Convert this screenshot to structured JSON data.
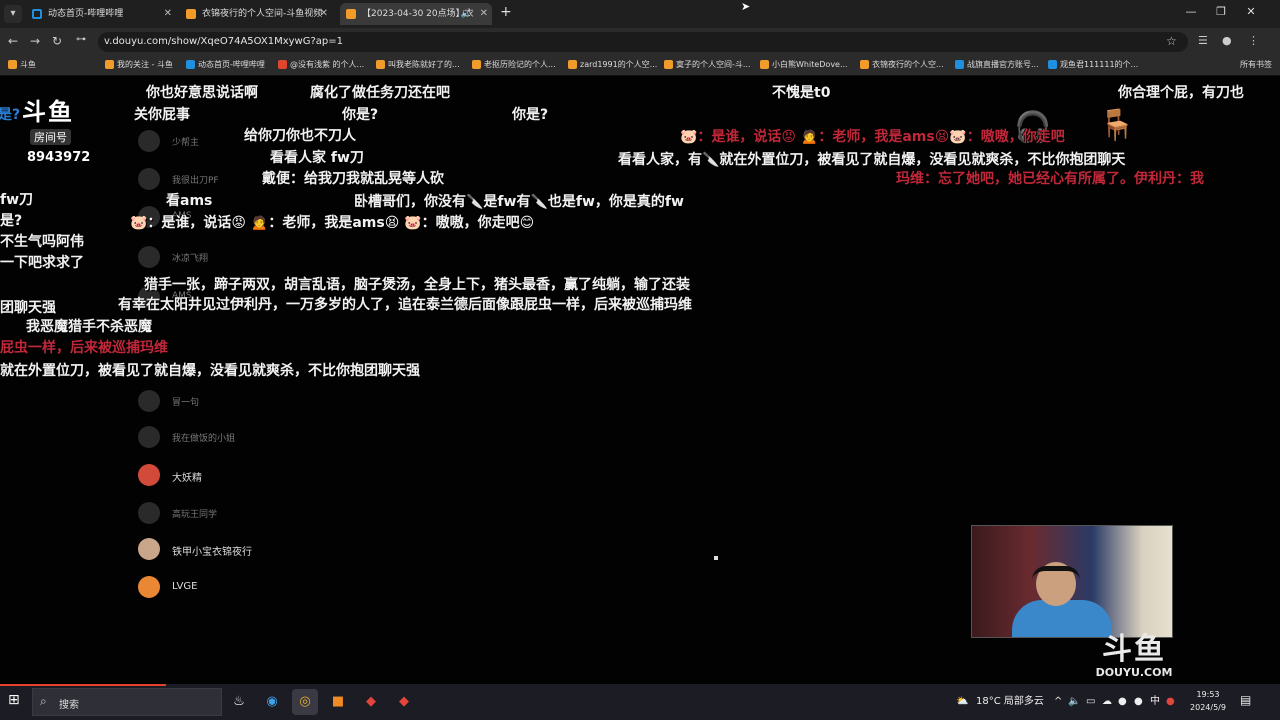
{
  "browser": {
    "tabs": [
      {
        "title": "动态首页-哔哩哔哩",
        "active": false,
        "fav": "#1f8fe0"
      },
      {
        "title": "衣锦夜行的个人空间-斗鱼视频",
        "active": false,
        "fav": "#f19c2a"
      },
      {
        "title": "【2023-04-30 20点场】衣",
        "active": true,
        "fav": "#f19c2a"
      }
    ],
    "url": "v.douyu.com/show/XqeO74A5OX1MxywG?ap=1",
    "bookmarks": [
      {
        "label": "斗鱼",
        "color": "#f19c2a"
      },
      {
        "label": "我的关注 - 斗鱼",
        "color": "#f19c2a"
      },
      {
        "label": "动态首页-哔哩哔哩",
        "color": "#1f8fe0"
      },
      {
        "label": "@没有浅紫 的个人...",
        "color": "#e0452f"
      },
      {
        "label": "叫我老陈就好了的...",
        "color": "#f19c2a"
      },
      {
        "label": "老抠历险记的个人...",
        "color": "#f19c2a"
      },
      {
        "label": "zard1991的个人空...",
        "color": "#f19c2a"
      },
      {
        "label": "寞子的个人空间-斗...",
        "color": "#f19c2a"
      },
      {
        "label": "小白熊WhiteDove...",
        "color": "#f19c2a"
      },
      {
        "label": "衣锦夜行的个人空...",
        "color": "#f19c2a"
      },
      {
        "label": "战旗直播官方账号...",
        "color": "#1f8fe0"
      },
      {
        "label": "观鱼君111111的个...",
        "color": "#1f8fe0"
      }
    ],
    "all_bookmarks": "所有书签"
  },
  "stream": {
    "logo_main": "斗鱼",
    "logo_sub": "房间号",
    "room_number": "8943972",
    "watermark_main": "斗鱼",
    "watermark_domain": "DOUYU.COM"
  },
  "danmaku": [
    {
      "text": "你也好意思说话啊",
      "cls": "white"
    },
    {
      "text": "腐化了做任务刀还在吧",
      "cls": "white"
    },
    {
      "text": "不愧是t0",
      "cls": "white"
    },
    {
      "text": "你合理个屁，有刀也",
      "cls": "white"
    },
    {
      "text": "是?",
      "cls": "blue"
    },
    {
      "text": "关你屁事",
      "cls": "white"
    },
    {
      "text": "你是?",
      "cls": "white"
    },
    {
      "text": "你是?",
      "cls": "white"
    },
    {
      "text": "给你刀你也不刀人",
      "cls": "white"
    },
    {
      "text": "🐷：是谁，说话😡  🙍：老师，我是ams😫🐷：嗷嗷，你走吧",
      "cls": "red"
    },
    {
      "text": "看看人家 fw刀",
      "cls": "white"
    },
    {
      "text": "看看人家，有🔪就在外置位刀，被看见了就自爆，没看见就爽杀，不比你抱团聊天",
      "cls": "white"
    },
    {
      "text": "戴便：给我刀我就乱晃等人砍",
      "cls": "white"
    },
    {
      "text": "玛维：忘了她吧，她已经心有所属了。伊利丹：我",
      "cls": "red"
    },
    {
      "text": "fw刀",
      "cls": "white"
    },
    {
      "text": "看ams",
      "cls": "white"
    },
    {
      "text": "卧槽哥们，你没有🔪是fw有🔪也是fw，你是真的fw",
      "cls": "white"
    },
    {
      "text": "是?",
      "cls": "white"
    },
    {
      "text": "🐷：是谁，说话😡  🙍：老师，我是ams😫  🐷：嗷嗷，你走吧😊",
      "cls": "white"
    },
    {
      "text": "不生气吗阿伟",
      "cls": "white"
    },
    {
      "text": "一下吧求求了",
      "cls": "white"
    },
    {
      "text": "猎手一张，蹄子两双，胡言乱语，脑子煲汤，全身上下，猪头最香，赢了纯躺，输了还装",
      "cls": "white"
    },
    {
      "text": "有幸在太阳井见过伊利丹，一万多岁的人了，追在泰兰德后面像跟屁虫一样，后来被巡捕玛维",
      "cls": "white"
    },
    {
      "text": "团聊天强",
      "cls": "white"
    },
    {
      "text": "我恶魔猎手不杀恶魔",
      "cls": "white"
    },
    {
      "text": "屁虫一样，后来被巡捕玛维",
      "cls": "red"
    },
    {
      "text": "就在外置位刀，被看见了就自爆，没看见就爽杀，不比你抱团聊天强",
      "cls": "white"
    }
  ],
  "players": [
    {
      "name": "少帮主",
      "bright": false
    },
    {
      "name": "我很出刀PF",
      "bright": false
    },
    {
      "name": "AMS",
      "bright": false
    },
    {
      "name": "冰凉飞翔",
      "bright": false
    },
    {
      "name": "AMS",
      "bright": false
    },
    {
      "name": "冒一句",
      "bright": false
    },
    {
      "name": "我在做饭的小姐",
      "bright": false
    },
    {
      "name": "大妖精",
      "bright": true
    },
    {
      "name": "高玩王同学",
      "bright": false
    },
    {
      "name": "铁甲小宝衣锦夜行",
      "bright": true
    },
    {
      "name": "LVGE",
      "bright": true
    }
  ],
  "taskbar": {
    "search_label": "搜索",
    "weather": "18°C  局部多云",
    "ime": "中",
    "time": "19:53",
    "date": "2024/5/9"
  }
}
